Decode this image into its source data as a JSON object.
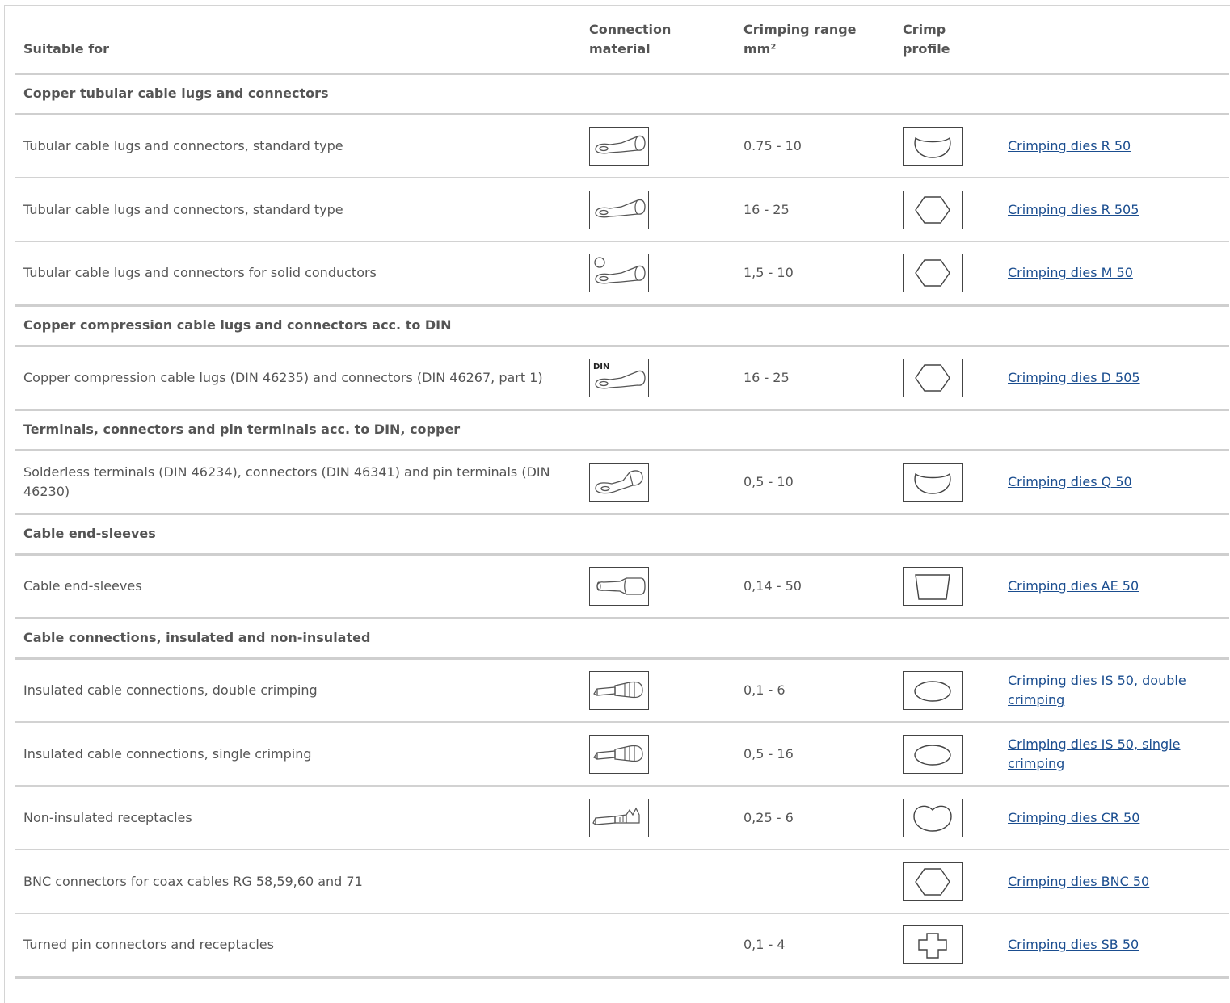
{
  "columns": {
    "suitable_for": "Suitable for",
    "connection_material": "Connection material",
    "crimping_range": "Crimping range mm²",
    "crimp_profile": "Crimp profile"
  },
  "sections": [
    {
      "title": "Copper tubular cable lugs and connectors",
      "rows": [
        {
          "suitable_for": "Tubular cable lugs and connectors, standard type",
          "material_icon": "tubular-lug-icon",
          "range": "0.75 - 10",
          "profile_icon": "crescent-profile-icon",
          "dies": "Crimping dies R 50"
        },
        {
          "suitable_for": "Tubular cable lugs and connectors, standard type",
          "material_icon": "tubular-lug-icon",
          "range": "16 - 25",
          "profile_icon": "hexagon-profile-icon",
          "dies": "Crimping dies R 505"
        },
        {
          "suitable_for": "Tubular cable lugs and connectors for solid conductors",
          "material_icon": "tubular-lug-solid-icon",
          "range": "1,5 - 10",
          "profile_icon": "hexagon-profile-icon",
          "dies": "Crimping dies M 50"
        }
      ]
    },
    {
      "title": "Copper compression cable lugs and connectors acc. to DIN",
      "rows": [
        {
          "suitable_for": "Copper compression cable lugs (DIN 46235) and connectors (DIN 46267, part 1)",
          "material_icon": "din-lug-icon",
          "din_label": "DIN",
          "range": "16 - 25",
          "profile_icon": "hexagon-profile-icon",
          "dies": "Crimping dies D 505"
        }
      ]
    },
    {
      "title": "Terminals, connectors and pin terminals acc. to DIN, copper",
      "rows": [
        {
          "suitable_for": "Solderless terminals (DIN 46234), connectors (DIN 46341) and pin terminals (DIN 46230)",
          "material_icon": "solderless-terminal-icon",
          "range": "0,5 - 10",
          "profile_icon": "crescent-profile-icon",
          "dies": "Crimping dies Q 50"
        }
      ]
    },
    {
      "title": "Cable end-sleeves",
      "rows": [
        {
          "suitable_for": "Cable end-sleeves",
          "material_icon": "end-sleeve-icon",
          "range": "0,14 - 50",
          "profile_icon": "trapezoid-profile-icon",
          "dies": "Crimping dies AE 50"
        }
      ]
    },
    {
      "title": "Cable connections, insulated and non-insulated",
      "rows": [
        {
          "suitable_for": "Insulated cable connections, double crimping",
          "material_icon": "insulated-connector-icon",
          "range": "0,1 - 6",
          "profile_icon": "oval-profile-icon",
          "dies": "Crimping dies IS 50, double crimping"
        },
        {
          "suitable_for": "Insulated cable connections, single crimping",
          "material_icon": "insulated-connector-icon",
          "range": "0,5 - 16",
          "profile_icon": "oval-profile-icon",
          "dies": "Crimping dies IS 50, single crimping"
        },
        {
          "suitable_for": "Non-insulated receptacles",
          "material_icon": "receptacle-icon",
          "range": "0,25 - 6",
          "profile_icon": "heart-profile-icon",
          "dies": "Crimping dies CR 50"
        },
        {
          "suitable_for": "BNC connectors for coax cables RG 58,59,60 and 71",
          "material_icon": "",
          "range": "",
          "profile_icon": "hexagon-profile-icon",
          "dies": "Crimping dies BNC 50"
        },
        {
          "suitable_for": "Turned pin connectors and receptacles",
          "material_icon": "",
          "range": "0,1 - 4",
          "profile_icon": "cross-profile-icon",
          "dies": "Crimping dies SB 50"
        }
      ]
    }
  ]
}
